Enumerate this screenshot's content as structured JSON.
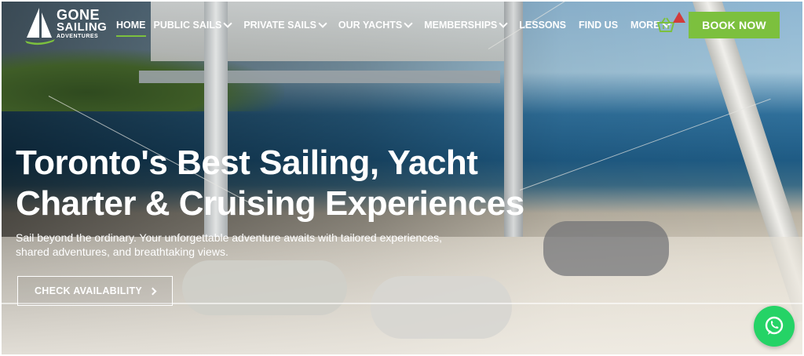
{
  "header": {
    "logo": {
      "line1": "GONE",
      "line2": "SAILING",
      "line3": "ADVENTURES",
      "icon": "sailboat-icon"
    },
    "nav": [
      {
        "label": "HOME",
        "active": true,
        "has_dropdown": false
      },
      {
        "label": "PUBLIC SAILS",
        "active": false,
        "has_dropdown": true
      },
      {
        "label": "PRIVATE SAILS",
        "active": false,
        "has_dropdown": true
      },
      {
        "label": "OUR YACHTS",
        "active": false,
        "has_dropdown": true
      },
      {
        "label": "MEMBERSHIPS",
        "active": false,
        "has_dropdown": true
      },
      {
        "label": "LESSONS",
        "active": false,
        "has_dropdown": false
      },
      {
        "label": "FIND US",
        "active": false,
        "has_dropdown": false
      },
      {
        "label": "MORE",
        "active": false,
        "has_dropdown": true
      }
    ],
    "cart_icon": "shopping-basket-icon",
    "book_button": "BOOK NOW"
  },
  "hero": {
    "headline_line1": "Toronto's Best Sailing, Yacht",
    "headline_line2": "Charter & Cruising Experiences",
    "subtext": "Sail beyond the ordinary. Your unforgettable adventure awaits with tailored experiences, shared adventures, and breathtaking views.",
    "cta": "CHECK AVAILABILITY"
  },
  "floating": {
    "whatsapp_icon": "whatsapp-icon"
  },
  "colors": {
    "accent_green": "#7cc03e",
    "whatsapp_green": "#25d366",
    "text_white": "#ffffff"
  }
}
